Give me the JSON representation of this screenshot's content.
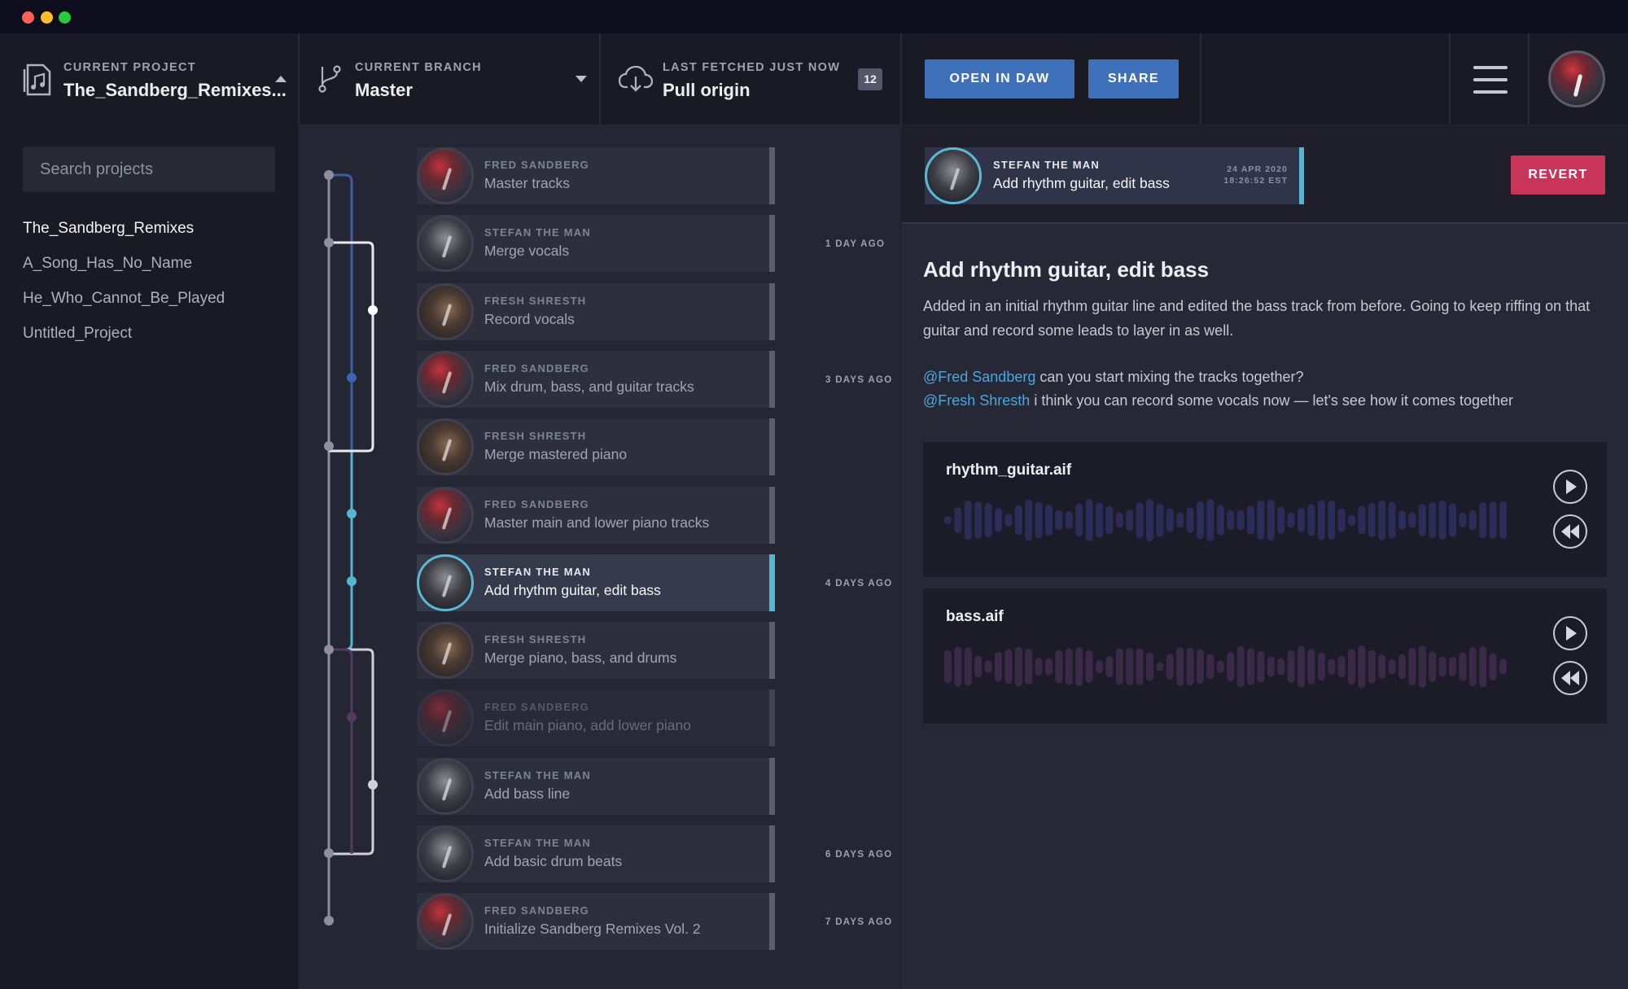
{
  "window": {
    "controls": [
      "close",
      "minimize",
      "maximize"
    ]
  },
  "header": {
    "project_label": "CURRENT PROJECT",
    "project_value": "The_Sandberg_Remixes...",
    "branch_label": "CURRENT BRANCH",
    "branch_value": "Master",
    "fetch_label": "LAST FETCHED JUST NOW",
    "fetch_value": "Pull origin",
    "fetch_badge": "12",
    "open_daw": "OPEN IN DAW",
    "share": "SHARE"
  },
  "sidebar": {
    "search_placeholder": "Search projects",
    "projects": [
      {
        "name": "The_Sandberg_Remixes",
        "active": true
      },
      {
        "name": "A_Song_Has_No_Name",
        "active": false
      },
      {
        "name": "He_Who_Cannot_Be_Played",
        "active": false
      },
      {
        "name": "Untitled_Project",
        "active": false
      }
    ]
  },
  "commits": [
    {
      "author": "FRED SANDBERG",
      "message": "Master tracks",
      "avatar": "fred",
      "ago": ""
    },
    {
      "author": "STEFAN THE MAN",
      "message": "Merge vocals",
      "avatar": "stefan",
      "ago": "1 DAY AGO"
    },
    {
      "author": "FRESH SHRESTH",
      "message": "Record vocals",
      "avatar": "fresh",
      "ago": ""
    },
    {
      "author": "FRED SANDBERG",
      "message": "Mix drum, bass, and guitar tracks",
      "avatar": "fred",
      "ago": "3 DAYS AGO"
    },
    {
      "author": "FRESH SHRESTH",
      "message": "Merge mastered piano",
      "avatar": "fresh",
      "ago": ""
    },
    {
      "author": "FRED SANDBERG",
      "message": "Master main and lower piano tracks",
      "avatar": "fred",
      "ago": ""
    },
    {
      "author": "STEFAN THE MAN",
      "message": "Add rhythm guitar, edit bass",
      "avatar": "stefan",
      "ago": "4 DAYS AGO",
      "selected": true
    },
    {
      "author": "FRESH SHRESTH",
      "message": "Merge piano, bass, and drums",
      "avatar": "fresh",
      "ago": ""
    },
    {
      "author": "FRED SANDBERG",
      "message": "Edit main piano, add lower piano",
      "avatar": "fred",
      "ago": "",
      "faded": true
    },
    {
      "author": "STEFAN THE MAN",
      "message": "Add bass line",
      "avatar": "stefan",
      "ago": ""
    },
    {
      "author": "STEFAN THE MAN",
      "message": "Add basic drum beats",
      "avatar": "stefan",
      "ago": "6 DAYS AGO"
    },
    {
      "author": "FRED SANDBERG",
      "message": "Initialize Sandberg Remixes Vol. 2",
      "avatar": "fred",
      "ago": "7 DAYS AGO"
    }
  ],
  "detail": {
    "author": "STEFAN THE MAN",
    "message": "Add rhythm guitar, edit bass",
    "date": "24 APR 2020",
    "time": "18:26:52 EST",
    "revert": "REVERT",
    "title": "Add rhythm guitar, edit bass",
    "body": "Added in an initial rhythm guitar line and edited the bass track from before. Going to keep riffing on that guitar and record some leads to layer in as well.",
    "mention1": "@Fred Sandberg",
    "mention1_text": " can you start mixing the tracks together?",
    "mention2": "@Fresh Shresth",
    "mention2_text": " i think you can record some vocals now — let's see how it comes together",
    "files": [
      {
        "name": "rhythm_guitar.aif",
        "color": "#2c2c58"
      },
      {
        "name": "bass.aif",
        "color": "#3a2a48"
      }
    ]
  },
  "colors": {
    "accent": "#3e71ba",
    "revert": "#c8345a",
    "selected": "#56b6cf",
    "mention": "#4aa7dd"
  }
}
